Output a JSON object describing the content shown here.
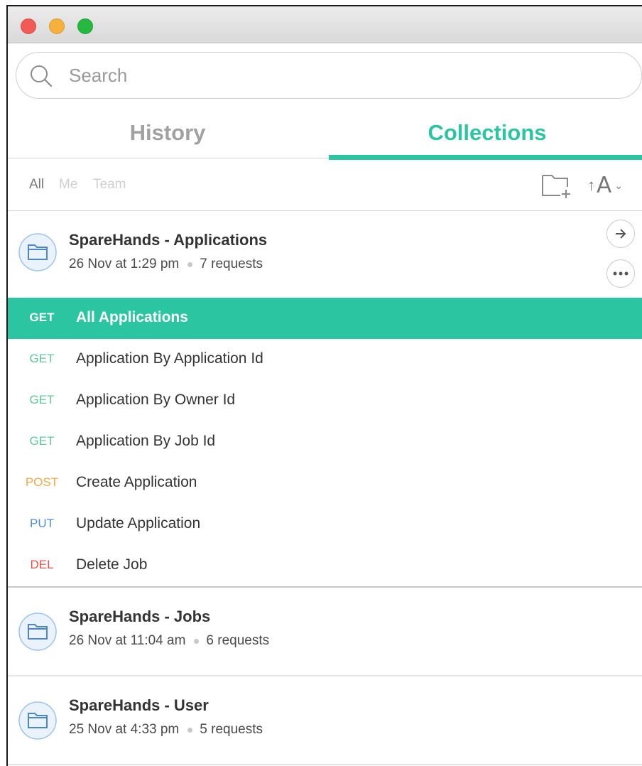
{
  "search": {
    "placeholder": "Search"
  },
  "tabs": {
    "history": "History",
    "collections": "Collections"
  },
  "filters": {
    "all": "All",
    "me": "Me",
    "team": "Team"
  },
  "sort": {
    "arrow": "↑",
    "letter": "A",
    "chevron": "⌄"
  },
  "collections": [
    {
      "name": "SpareHands - Applications",
      "date": "26 Nov at 1:29 pm",
      "count": "7 requests",
      "requests": [
        {
          "method": "GET",
          "name": "All Applications",
          "active": true
        },
        {
          "method": "GET",
          "name": "Application By Application Id"
        },
        {
          "method": "GET",
          "name": "Application By Owner Id"
        },
        {
          "method": "GET",
          "name": "Application By Job Id"
        },
        {
          "method": "POST",
          "name": "Create Application"
        },
        {
          "method": "PUT",
          "name": "Update Application"
        },
        {
          "method": "DEL",
          "name": "Delete Job"
        }
      ]
    },
    {
      "name": "SpareHands - Jobs",
      "date": "26 Nov at 11:04 am",
      "count": "6 requests"
    },
    {
      "name": "SpareHands - User",
      "date": "25 Nov at 4:33 pm",
      "count": "5 requests"
    }
  ],
  "colors": {
    "accent": "#2cc5a2",
    "get": "#5fc896",
    "post": "#f1a845",
    "put": "#4d8fd6",
    "del": "#e8504a"
  }
}
